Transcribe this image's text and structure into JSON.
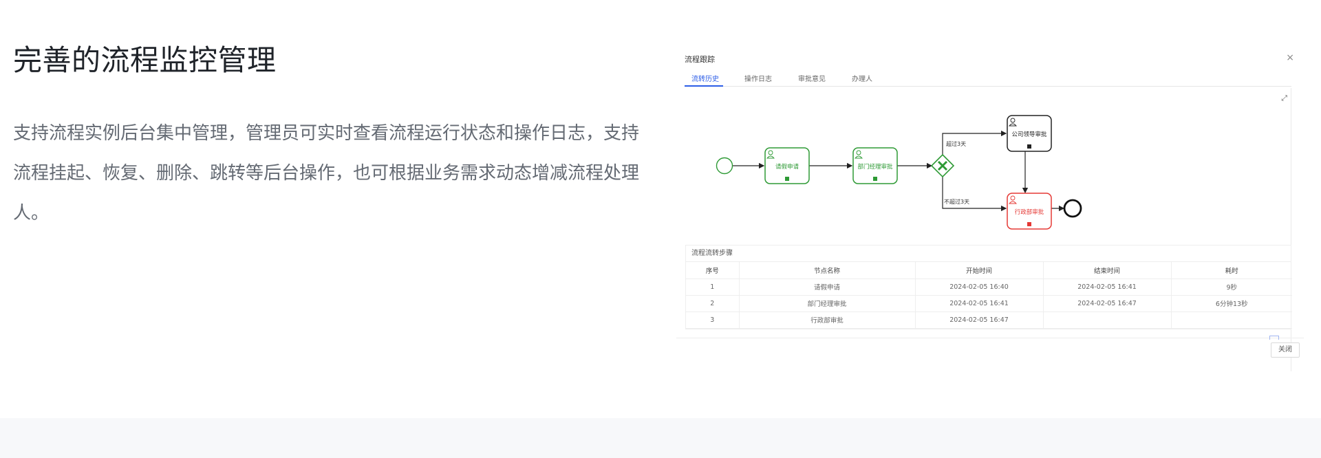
{
  "headline": "完善的流程监控管理",
  "description": "支持流程实例后台集中管理，管理员可实时查看流程运行状态和操作日志，支持流程挂起、恢复、删除、跳转等后台操作，也可根据业务需求动态增减流程处理人。",
  "dialog": {
    "title": "流程跟踪",
    "close_icon": "×",
    "expand_icon": "⤢",
    "tabs": [
      "流转历史",
      "操作日志",
      "审批意见",
      "办理人"
    ],
    "active_tab": "流转历史",
    "flow": {
      "nodes": {
        "apply": "请假申请",
        "dept": "部门经理审批",
        "gm": "公司领导审批",
        "admin": "行政部审批"
      },
      "conditions": {
        "over": "超过3天",
        "not_over": "不超过3天"
      },
      "colors": {
        "done": "#2e9a35",
        "current": "#e53935",
        "pending": "#333333"
      }
    },
    "steps": {
      "title": "流程流转步骤",
      "columns": [
        "序号",
        "节点名称",
        "开始时间",
        "结束时间",
        "耗时"
      ],
      "rows": [
        [
          "1",
          "请假申请",
          "2024-02-05 16:40",
          "2024-02-05 16:41",
          "9秒"
        ],
        [
          "2",
          "部门经理审批",
          "2024-02-05 16:41",
          "2024-02-05 16:47",
          "6分钟13秒"
        ],
        [
          "3",
          "行政部审批",
          "2024-02-05 16:47",
          "",
          ""
        ]
      ]
    },
    "close_button": "关闭"
  }
}
